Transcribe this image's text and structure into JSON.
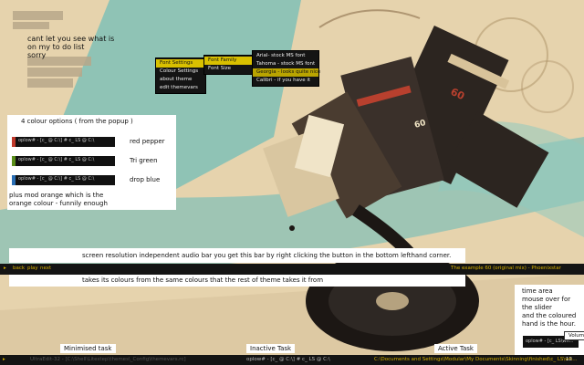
{
  "background_colors": {
    "paper": "#e6d3ad",
    "teal": "#7fbfb6",
    "dark": "#2c2520",
    "amber": "#d8b200",
    "tape_red": "#b8402e"
  },
  "notes": {
    "top_left": [
      "cant let you see what is",
      "on my to do list",
      "sorry"
    ]
  },
  "context_menu": {
    "main": [
      "Font Settings",
      "Colour Settings",
      "about theme",
      "edit themevars"
    ],
    "font_menu": [
      "Font Family",
      "Font Size"
    ],
    "family_menu": [
      "Arial- stock MS font",
      "Tahoma - stock MS font",
      "Georgia - looks quite nice",
      "Calibri - if you have it"
    ]
  },
  "colour_panel": {
    "heading": "4 colour options ( from the popup )",
    "bar_text": "oplow# - [c_ @ C:\\] # c_ LS @ C:\\",
    "options": [
      {
        "name": "red pepper",
        "color": "#c0392b"
      },
      {
        "name": "Tri green",
        "color": "#5b8f1a"
      },
      {
        "name": "drop blue",
        "color": "#2a6fb5"
      }
    ],
    "footer": [
      "plus mod orange which is the",
      "orange colour - funnily enough"
    ]
  },
  "audio_panel": {
    "top_text": "screen resolution independent audio bar you get this bar by right clicking the button in the bottom lefthand corner.",
    "bottom_text": "takes its colours from the same colours that the rest of theme takes it from"
  },
  "media_bar": {
    "buttons": [
      "back",
      "play",
      "next"
    ],
    "track": "The example 60 (original mix) - Phoenixstar"
  },
  "time_panel": {
    "lines": [
      "time area",
      "mouse over for",
      "the slider",
      "and the coloured",
      "hand is the hour."
    ],
    "volume_label": "Volume",
    "mini_text": "oplow# - [c_ LS\\wh..."
  },
  "callouts": {
    "minimised": "Minimised task",
    "inactive": "Inactive Task",
    "active": "Active Task"
  },
  "taskbar": {
    "minimised": "UltraEdit-32 - [C:\\Shell\\Litestep\\themes\\_Config\\themevars.rc]",
    "inactive": "oplow# - [c_ @ C:\\] # c_ LS @ C:\\",
    "active": "C:\\Documents and Settings\\Modular\\My Documents\\Skinning\\finished\\c_ LS\\wh...",
    "clock": "12"
  },
  "tape_labels": [
    "60",
    "60"
  ]
}
